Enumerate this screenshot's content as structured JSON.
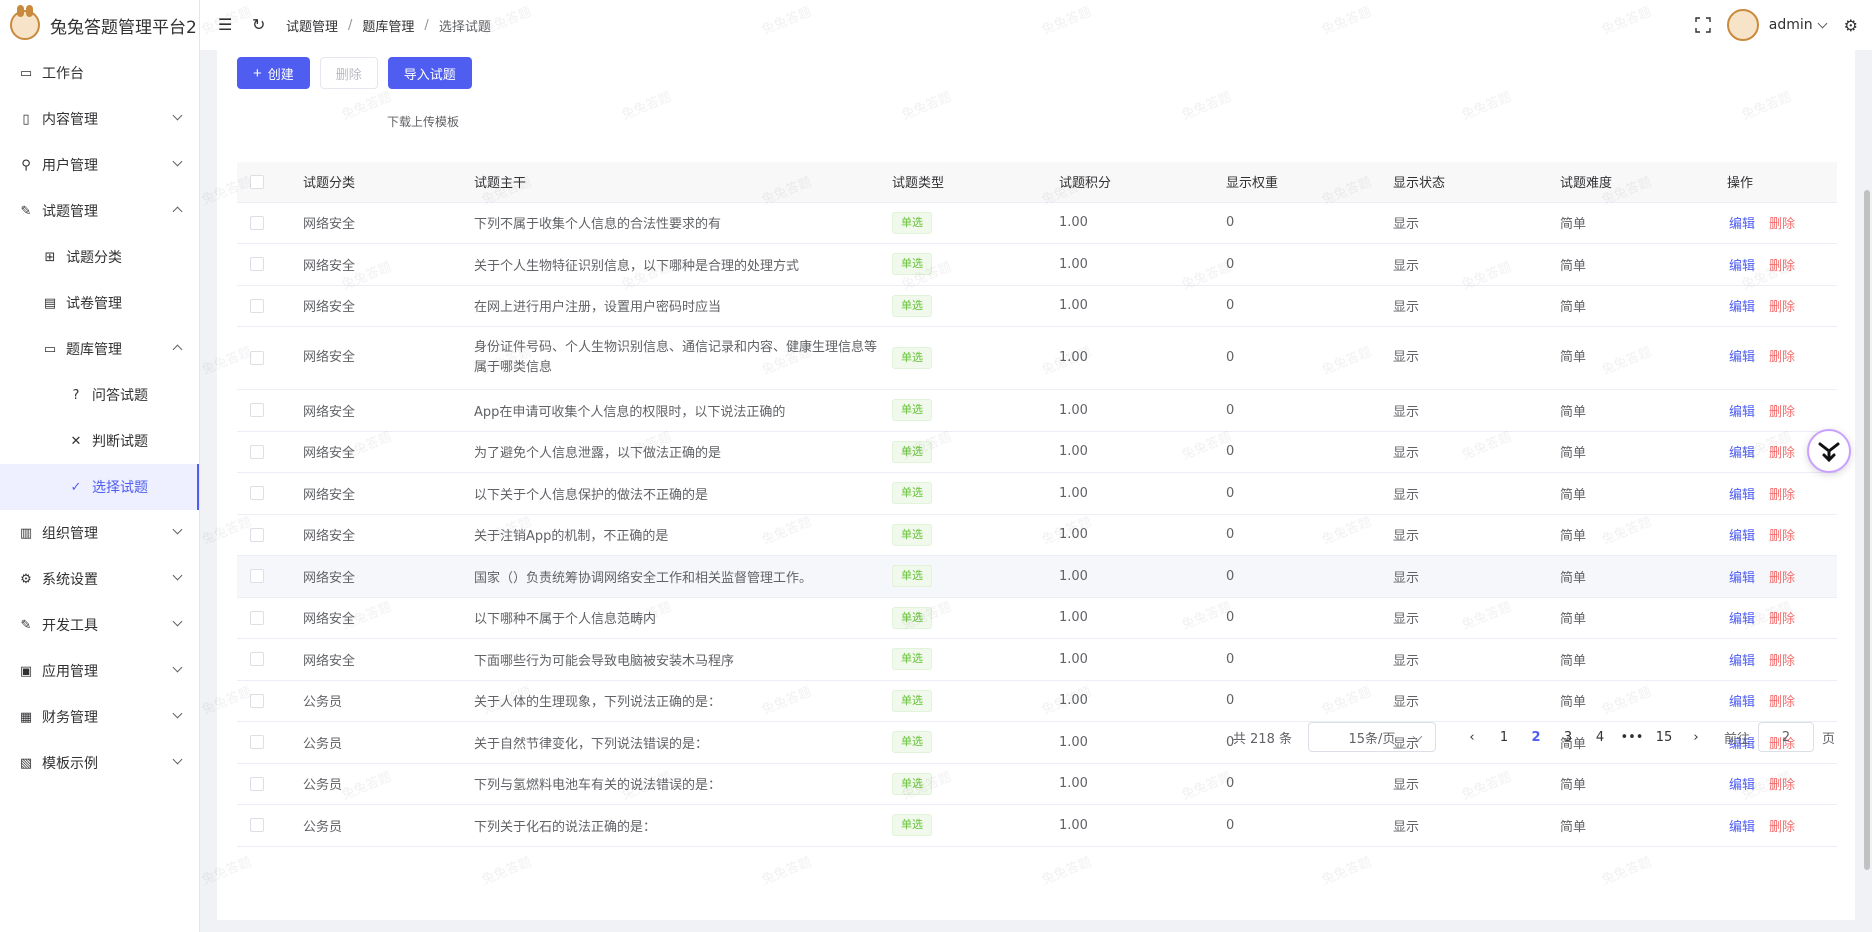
{
  "app": {
    "title": "兔兔答题管理平台2"
  },
  "sidebar": {
    "items": [
      {
        "label": "工作台",
        "icon": "monitor-icon"
      },
      {
        "label": "内容管理",
        "icon": "book-icon"
      },
      {
        "label": "用户管理",
        "icon": "user-icon"
      },
      {
        "label": "试题管理",
        "icon": "edit-pen-icon"
      },
      {
        "label": "试题分类",
        "icon": "doc-add-icon"
      },
      {
        "label": "试卷管理",
        "icon": "document-icon"
      },
      {
        "label": "题库管理",
        "icon": "folder-icon"
      },
      {
        "label": "问答试题",
        "icon": "question-circle-icon"
      },
      {
        "label": "判断试题",
        "icon": "close-icon"
      },
      {
        "label": "选择试题",
        "icon": "check-circle-icon"
      },
      {
        "label": "组织管理",
        "icon": "building-icon"
      },
      {
        "label": "系统设置",
        "icon": "gear-icon"
      },
      {
        "label": "开发工具",
        "icon": "pen-tool-icon"
      },
      {
        "label": "应用管理",
        "icon": "app-icon"
      },
      {
        "label": "财务管理",
        "icon": "chart-icon"
      },
      {
        "label": "模板示例",
        "icon": "template-icon"
      }
    ]
  },
  "header": {
    "breadcrumb": [
      "试题管理",
      "题库管理",
      "选择试题"
    ],
    "separator": "/",
    "username": "admin"
  },
  "toolbar": {
    "create_label": "创建",
    "delete_label": "删除",
    "import_label": "导入试题",
    "download_label": "下载上传模板"
  },
  "table": {
    "columns": [
      "试题分类",
      "试题主干",
      "试题类型",
      "试题积分",
      "显示权重",
      "显示状态",
      "试题难度",
      "操作"
    ],
    "edit_label": "编辑",
    "delete_label": "删除",
    "rows": [
      {
        "category": "网络安全",
        "stem": "下列不属于收集个人信息的合法性要求的有",
        "type": "单选",
        "score": "1.00",
        "weight": "0",
        "status": "显示",
        "difficulty": "简单"
      },
      {
        "category": "网络安全",
        "stem": "关于个人生物特征识别信息，以下哪种是合理的处理方式",
        "type": "单选",
        "score": "1.00",
        "weight": "0",
        "status": "显示",
        "difficulty": "简单"
      },
      {
        "category": "网络安全",
        "stem": "在网上进行用户注册，设置用户密码时应当",
        "type": "单选",
        "score": "1.00",
        "weight": "0",
        "status": "显示",
        "difficulty": "简单"
      },
      {
        "category": "网络安全",
        "stem": "身份证件号码、个人生物识别信息、通信记录和内容、健康生理信息等属于哪类信息",
        "type": "单选",
        "score": "1.00",
        "weight": "0",
        "status": "显示",
        "difficulty": "简单"
      },
      {
        "category": "网络安全",
        "stem": "App在申请可收集个人信息的权限时，以下说法正确的",
        "type": "单选",
        "score": "1.00",
        "weight": "0",
        "status": "显示",
        "difficulty": "简单"
      },
      {
        "category": "网络安全",
        "stem": "为了避免个人信息泄露，以下做法正确的是",
        "type": "单选",
        "score": "1.00",
        "weight": "0",
        "status": "显示",
        "difficulty": "简单"
      },
      {
        "category": "网络安全",
        "stem": "以下关于个人信息保护的做法不正确的是",
        "type": "单选",
        "score": "1.00",
        "weight": "0",
        "status": "显示",
        "difficulty": "简单"
      },
      {
        "category": "网络安全",
        "stem": "关于注销App的机制，不正确的是",
        "type": "单选",
        "score": "1.00",
        "weight": "0",
        "status": "显示",
        "difficulty": "简单"
      },
      {
        "category": "网络安全",
        "stem": "国家（）负责统筹协调网络安全工作和相关监督管理工作。",
        "type": "单选",
        "score": "1.00",
        "weight": "0",
        "status": "显示",
        "difficulty": "简单"
      },
      {
        "category": "网络安全",
        "stem": "以下哪种不属于个人信息范畴内",
        "type": "单选",
        "score": "1.00",
        "weight": "0",
        "status": "显示",
        "difficulty": "简单"
      },
      {
        "category": "网络安全",
        "stem": "下面哪些行为可能会导致电脑被安装木马程序",
        "type": "单选",
        "score": "1.00",
        "weight": "0",
        "status": "显示",
        "difficulty": "简单"
      },
      {
        "category": "公务员",
        "stem": "关于人体的生理现象，下列说法正确的是：",
        "type": "单选",
        "score": "1.00",
        "weight": "0",
        "status": "显示",
        "difficulty": "简单"
      },
      {
        "category": "公务员",
        "stem": "关于自然节律变化，下列说法错误的是：",
        "type": "单选",
        "score": "1.00",
        "weight": "0",
        "status": "显示",
        "difficulty": "简单"
      },
      {
        "category": "公务员",
        "stem": "下列与氢燃料电池车有关的说法错误的是：",
        "type": "单选",
        "score": "1.00",
        "weight": "0",
        "status": "显示",
        "difficulty": "简单"
      },
      {
        "category": "公务员",
        "stem": "下列关于化石的说法正确的是：",
        "type": "单选",
        "score": "1.00",
        "weight": "0",
        "status": "显示",
        "difficulty": "简单"
      }
    ]
  },
  "pagination": {
    "total_text": "共 218 条",
    "page_size": "15条/页",
    "pages": [
      "1",
      "2",
      "3",
      "4",
      "•••",
      "15"
    ],
    "current": "2",
    "goto_label": "前往",
    "goto_value": "2",
    "page_suffix": "页"
  },
  "watermark": "兔兔答题",
  "colors": {
    "primary": "#4f5ef0",
    "danger": "#f56c6c",
    "success": "#67c23a"
  }
}
